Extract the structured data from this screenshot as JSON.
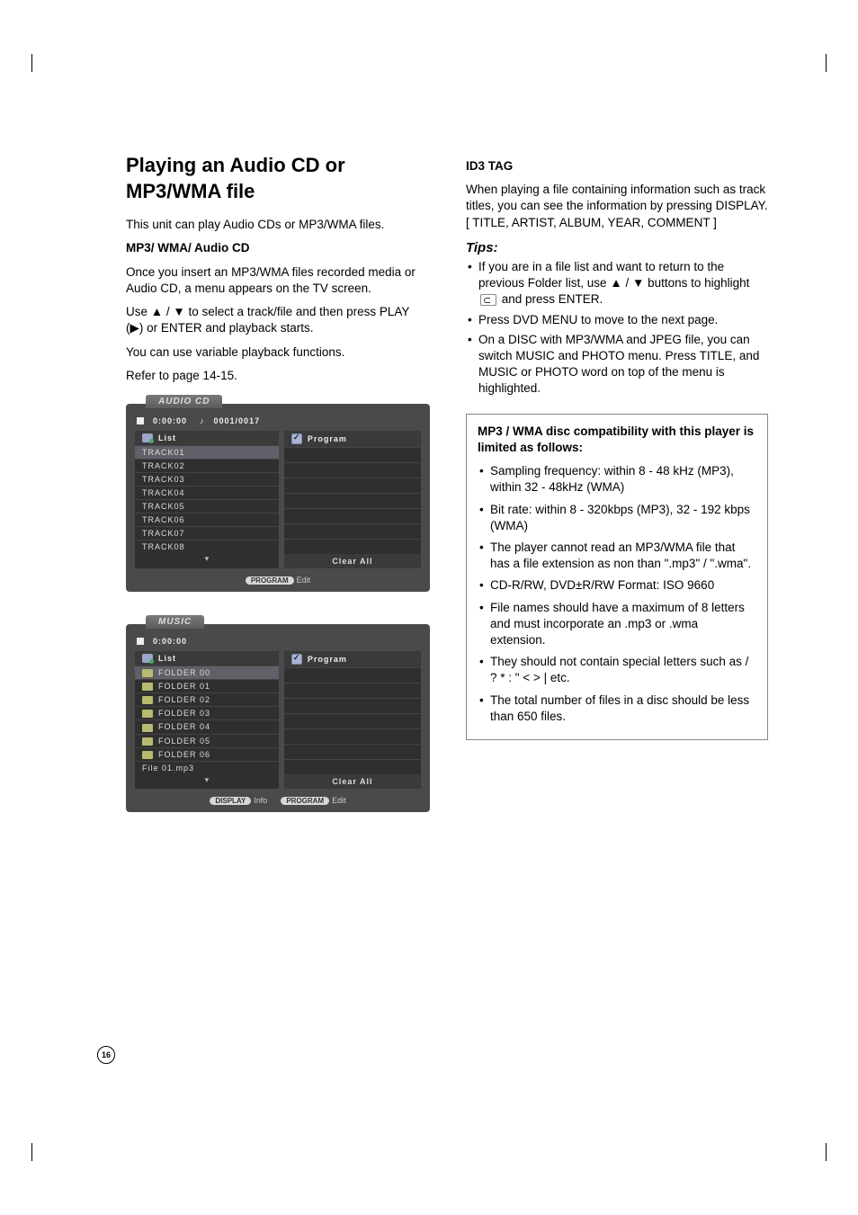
{
  "page": {
    "number": "16",
    "left": {
      "title": "Playing an Audio CD or MP3/WMA file",
      "intro": "This unit can play Audio CDs or MP3/WMA files.",
      "subheading": "MP3/ WMA/ Audio CD",
      "body1": "Once you insert an MP3/WMA files recorded media or Audio CD, a menu appears on the TV screen.",
      "body2_pre": "Use ",
      "up": "▲",
      "slash": " / ",
      "down": "▼",
      "body2_mid": " to select a track/file and then press PLAY (",
      "play": "▶",
      "body2_post": ") or ENTER and playback starts.",
      "body3": "You can use variable playback functions.",
      "body4": "Refer to page 14-15.",
      "osd1": {
        "tab": "AUDIO CD",
        "time": "0:00:00",
        "counter": " 0001/0017",
        "list_label": "List",
        "program_label": "Program",
        "tracks": [
          "TRACK01",
          "TRACK02",
          "TRACK03",
          "TRACK04",
          "TRACK05",
          "TRACK06",
          "TRACK07",
          "TRACK08"
        ],
        "clear_all": "Clear All",
        "prog_pill": "PROGRAM",
        "edit": "Edit"
      },
      "osd2": {
        "tab": "MUSIC",
        "time": "0:00:00",
        "list_label": "List",
        "program_label": "Program",
        "folders": [
          "FOLDER 00",
          "FOLDER 01",
          "FOLDER 02",
          "FOLDER 03",
          "FOLDER 04",
          "FOLDER 05",
          "FOLDER 06"
        ],
        "file": "File 01.mp3",
        "clear_all": "Clear All",
        "disp_pill": "DISPLAY",
        "info": "Info",
        "prog_pill": "PROGRAM",
        "edit": "Edit"
      }
    },
    "right": {
      "id3_heading": "ID3 TAG",
      "id3_body": "When playing a file containing information such as track titles, you can see the information by pressing DISPLAY. [ TITLE, ARTIST, ALBUM, YEAR, COMMENT ]",
      "tips_label": "Tips:",
      "tip1_pre": "If you are in a file list and want to return to the previous Folder list, use ",
      "up": "▲",
      "slash": " / ",
      "down": "▼",
      "tip1_post": " buttons to highlight ",
      "tip1_end": " and press ENTER.",
      "tip2": "Press DVD MENU to move to the next page.",
      "tip3": "On a DISC with MP3/WMA and JPEG file, you can switch MUSIC and PHOTO menu. Press TITLE, and MUSIC or PHOTO word on top of the menu is highlighted.",
      "box_title": "MP3 / WMA disc compatibility with this player is limited as follows:",
      "box_items": [
        "Sampling frequency: within 8 - 48 kHz (MP3), within 32 - 48kHz (WMA)",
        "Bit rate: within 8 - 320kbps (MP3), 32 - 192 kbps (WMA)",
        "The player cannot read an MP3/WMA file that has a file extension as non than \".mp3\" / \".wma\".",
        "CD-R/RW, DVD±R/RW Format: ISO 9660",
        "File names should have a maximum of 8 letters and must incorporate an .mp3 or .wma extension.",
        "They should not contain special letters such as / ? * : \" < > | etc.",
        "The total number of files in a disc should be less than 650 files."
      ]
    }
  }
}
